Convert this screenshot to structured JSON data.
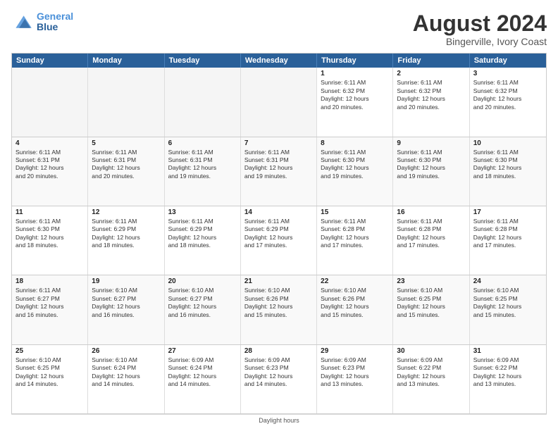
{
  "logo": {
    "line1": "General",
    "line2": "Blue"
  },
  "title": "August 2024",
  "subtitle": "Bingerville, Ivory Coast",
  "header_days": [
    "Sunday",
    "Monday",
    "Tuesday",
    "Wednesday",
    "Thursday",
    "Friday",
    "Saturday"
  ],
  "footer": "Daylight hours",
  "weeks": [
    [
      {
        "day": "",
        "info": "",
        "empty": true
      },
      {
        "day": "",
        "info": "",
        "empty": true
      },
      {
        "day": "",
        "info": "",
        "empty": true
      },
      {
        "day": "",
        "info": "",
        "empty": true
      },
      {
        "day": "1",
        "info": "Sunrise: 6:11 AM\nSunset: 6:32 PM\nDaylight: 12 hours\nand 20 minutes.",
        "empty": false
      },
      {
        "day": "2",
        "info": "Sunrise: 6:11 AM\nSunset: 6:32 PM\nDaylight: 12 hours\nand 20 minutes.",
        "empty": false
      },
      {
        "day": "3",
        "info": "Sunrise: 6:11 AM\nSunset: 6:32 PM\nDaylight: 12 hours\nand 20 minutes.",
        "empty": false
      }
    ],
    [
      {
        "day": "4",
        "info": "Sunrise: 6:11 AM\nSunset: 6:31 PM\nDaylight: 12 hours\nand 20 minutes.",
        "empty": false
      },
      {
        "day": "5",
        "info": "Sunrise: 6:11 AM\nSunset: 6:31 PM\nDaylight: 12 hours\nand 20 minutes.",
        "empty": false
      },
      {
        "day": "6",
        "info": "Sunrise: 6:11 AM\nSunset: 6:31 PM\nDaylight: 12 hours\nand 19 minutes.",
        "empty": false
      },
      {
        "day": "7",
        "info": "Sunrise: 6:11 AM\nSunset: 6:31 PM\nDaylight: 12 hours\nand 19 minutes.",
        "empty": false
      },
      {
        "day": "8",
        "info": "Sunrise: 6:11 AM\nSunset: 6:30 PM\nDaylight: 12 hours\nand 19 minutes.",
        "empty": false
      },
      {
        "day": "9",
        "info": "Sunrise: 6:11 AM\nSunset: 6:30 PM\nDaylight: 12 hours\nand 19 minutes.",
        "empty": false
      },
      {
        "day": "10",
        "info": "Sunrise: 6:11 AM\nSunset: 6:30 PM\nDaylight: 12 hours\nand 18 minutes.",
        "empty": false
      }
    ],
    [
      {
        "day": "11",
        "info": "Sunrise: 6:11 AM\nSunset: 6:30 PM\nDaylight: 12 hours\nand 18 minutes.",
        "empty": false
      },
      {
        "day": "12",
        "info": "Sunrise: 6:11 AM\nSunset: 6:29 PM\nDaylight: 12 hours\nand 18 minutes.",
        "empty": false
      },
      {
        "day": "13",
        "info": "Sunrise: 6:11 AM\nSunset: 6:29 PM\nDaylight: 12 hours\nand 18 minutes.",
        "empty": false
      },
      {
        "day": "14",
        "info": "Sunrise: 6:11 AM\nSunset: 6:29 PM\nDaylight: 12 hours\nand 17 minutes.",
        "empty": false
      },
      {
        "day": "15",
        "info": "Sunrise: 6:11 AM\nSunset: 6:28 PM\nDaylight: 12 hours\nand 17 minutes.",
        "empty": false
      },
      {
        "day": "16",
        "info": "Sunrise: 6:11 AM\nSunset: 6:28 PM\nDaylight: 12 hours\nand 17 minutes.",
        "empty": false
      },
      {
        "day": "17",
        "info": "Sunrise: 6:11 AM\nSunset: 6:28 PM\nDaylight: 12 hours\nand 17 minutes.",
        "empty": false
      }
    ],
    [
      {
        "day": "18",
        "info": "Sunrise: 6:11 AM\nSunset: 6:27 PM\nDaylight: 12 hours\nand 16 minutes.",
        "empty": false
      },
      {
        "day": "19",
        "info": "Sunrise: 6:10 AM\nSunset: 6:27 PM\nDaylight: 12 hours\nand 16 minutes.",
        "empty": false
      },
      {
        "day": "20",
        "info": "Sunrise: 6:10 AM\nSunset: 6:27 PM\nDaylight: 12 hours\nand 16 minutes.",
        "empty": false
      },
      {
        "day": "21",
        "info": "Sunrise: 6:10 AM\nSunset: 6:26 PM\nDaylight: 12 hours\nand 15 minutes.",
        "empty": false
      },
      {
        "day": "22",
        "info": "Sunrise: 6:10 AM\nSunset: 6:26 PM\nDaylight: 12 hours\nand 15 minutes.",
        "empty": false
      },
      {
        "day": "23",
        "info": "Sunrise: 6:10 AM\nSunset: 6:25 PM\nDaylight: 12 hours\nand 15 minutes.",
        "empty": false
      },
      {
        "day": "24",
        "info": "Sunrise: 6:10 AM\nSunset: 6:25 PM\nDaylight: 12 hours\nand 15 minutes.",
        "empty": false
      }
    ],
    [
      {
        "day": "25",
        "info": "Sunrise: 6:10 AM\nSunset: 6:25 PM\nDaylight: 12 hours\nand 14 minutes.",
        "empty": false
      },
      {
        "day": "26",
        "info": "Sunrise: 6:10 AM\nSunset: 6:24 PM\nDaylight: 12 hours\nand 14 minutes.",
        "empty": false
      },
      {
        "day": "27",
        "info": "Sunrise: 6:09 AM\nSunset: 6:24 PM\nDaylight: 12 hours\nand 14 minutes.",
        "empty": false
      },
      {
        "day": "28",
        "info": "Sunrise: 6:09 AM\nSunset: 6:23 PM\nDaylight: 12 hours\nand 14 minutes.",
        "empty": false
      },
      {
        "day": "29",
        "info": "Sunrise: 6:09 AM\nSunset: 6:23 PM\nDaylight: 12 hours\nand 13 minutes.",
        "empty": false
      },
      {
        "day": "30",
        "info": "Sunrise: 6:09 AM\nSunset: 6:22 PM\nDaylight: 12 hours\nand 13 minutes.",
        "empty": false
      },
      {
        "day": "31",
        "info": "Sunrise: 6:09 AM\nSunset: 6:22 PM\nDaylight: 12 hours\nand 13 minutes.",
        "empty": false
      }
    ]
  ]
}
